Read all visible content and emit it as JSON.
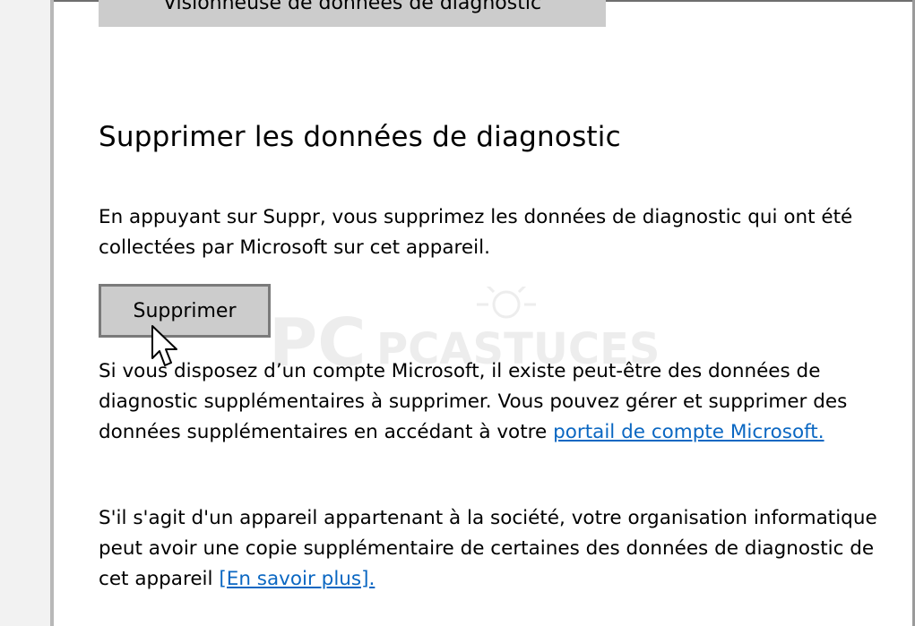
{
  "viewer_button": {
    "label": "Visionneuse de données de diagnostic"
  },
  "section": {
    "title": "Supprimer les données de diagnostic",
    "intro": "En appuyant sur Suppr, vous supprimez les données de diagnostic qui ont été collectées par Microsoft sur cet appareil.",
    "delete_button_label": "Supprimer",
    "account_text": "Si vous disposez d’un compte Microsoft, il existe peut-être des données de diagnostic supplémentaires à supprimer. Vous pouvez gérer et supprimer des données supplémentaires en accédant à votre ",
    "account_link": "portail de compte Microsoft.",
    "org_text": "S'il s'agit d'un appareil appartenant à la société, votre organisation informatique peut avoir une copie supplémentaire de certaines des données de diagnostic de cet appareil ",
    "learn_more_link": "[En savoir plus]."
  },
  "watermark": {
    "text": "PCASTUCES"
  },
  "colors": {
    "link": "#0a67c2",
    "button_bg": "#cccccc",
    "button_border": "#7a7a7a"
  },
  "icons": {
    "cursor": "mouse-pointer-icon"
  }
}
